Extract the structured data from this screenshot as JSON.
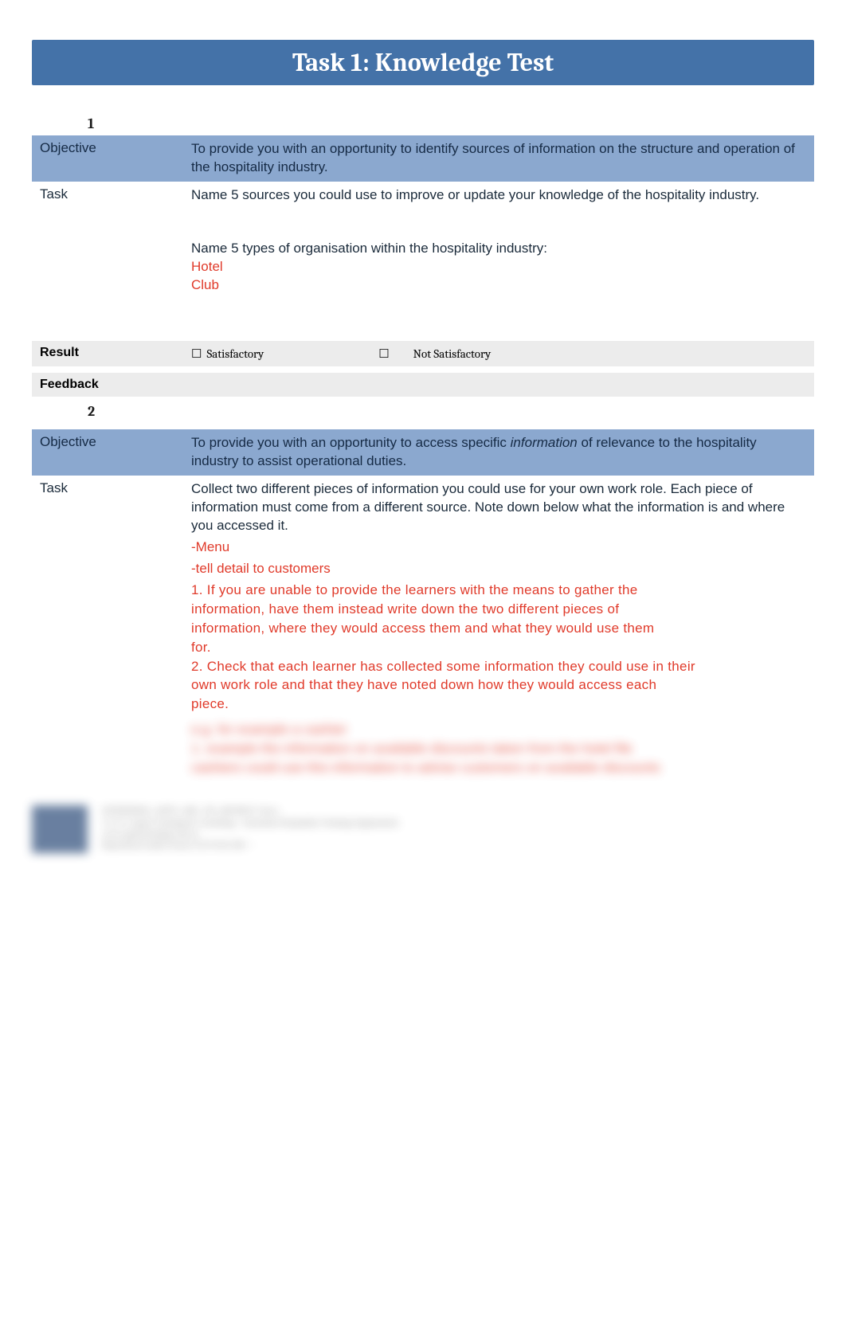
{
  "title": "Task 1: Knowledge Test",
  "section1": {
    "number": "1",
    "objective_label": "Objective",
    "objective_text": "To provide you with an opportunity to identify sources of information on the structure and operation of the hospitality industry.",
    "task_label": "Task",
    "task_text1": "Name 5 sources you could use to improve or update your knowledge of the hospitality industry.",
    "task_text2": "Name 5 types of organisation within the hospitality industry:",
    "answer1": "Hotel",
    "answer2": "Club",
    "result_label": "Result",
    "satisfactory": "Satisfactory",
    "not_satisfactory": "Not Satisfactory",
    "feedback_label": "Feedback"
  },
  "section2": {
    "number": "2",
    "objective_label": "Objective",
    "objective_text_pre": "To provide you with an opportunity to access specific ",
    "objective_text_italic": "information",
    "objective_text_post": " of relevance to the hospitality industry to assist operational duties.",
    "task_label": "Task",
    "task_text": "Collect two different pieces of information you could use for your own work role. Each piece of information must come from a different source. Note down below what the information is and where you accessed it.",
    "red_a": "-Menu",
    "red_b": "-tell detail to customers",
    "red_lines": [
      "1. If you are unable to provide the learners with the means to gather the",
      "information, have them instead write down the two different pieces of",
      "information, where they would access them and what they would use them",
      "for.",
      "2. Check that each learner has collected some information they could use in their",
      "own work role and that they have noted down how they would access each",
      "piece."
    ],
    "blurred_lines": [
      "e.g. for example a cashier",
      "1. example the information on available discounts taken from the hotel file",
      "cashiers could use this information to advise customers on available discounts"
    ]
  },
  "footer": {
    "line1": "SITHIND002_AHTS_ABC_NZ_485309217.docx",
    "line2": "V1.0  ©  Aspire  Training &  Consulting  · Australian  Hospitality  Training  Organisation",
    "line3": "www.aspiretraining.com.au",
    "line4": "Reproduced under licence ACN 054 306 ···"
  }
}
